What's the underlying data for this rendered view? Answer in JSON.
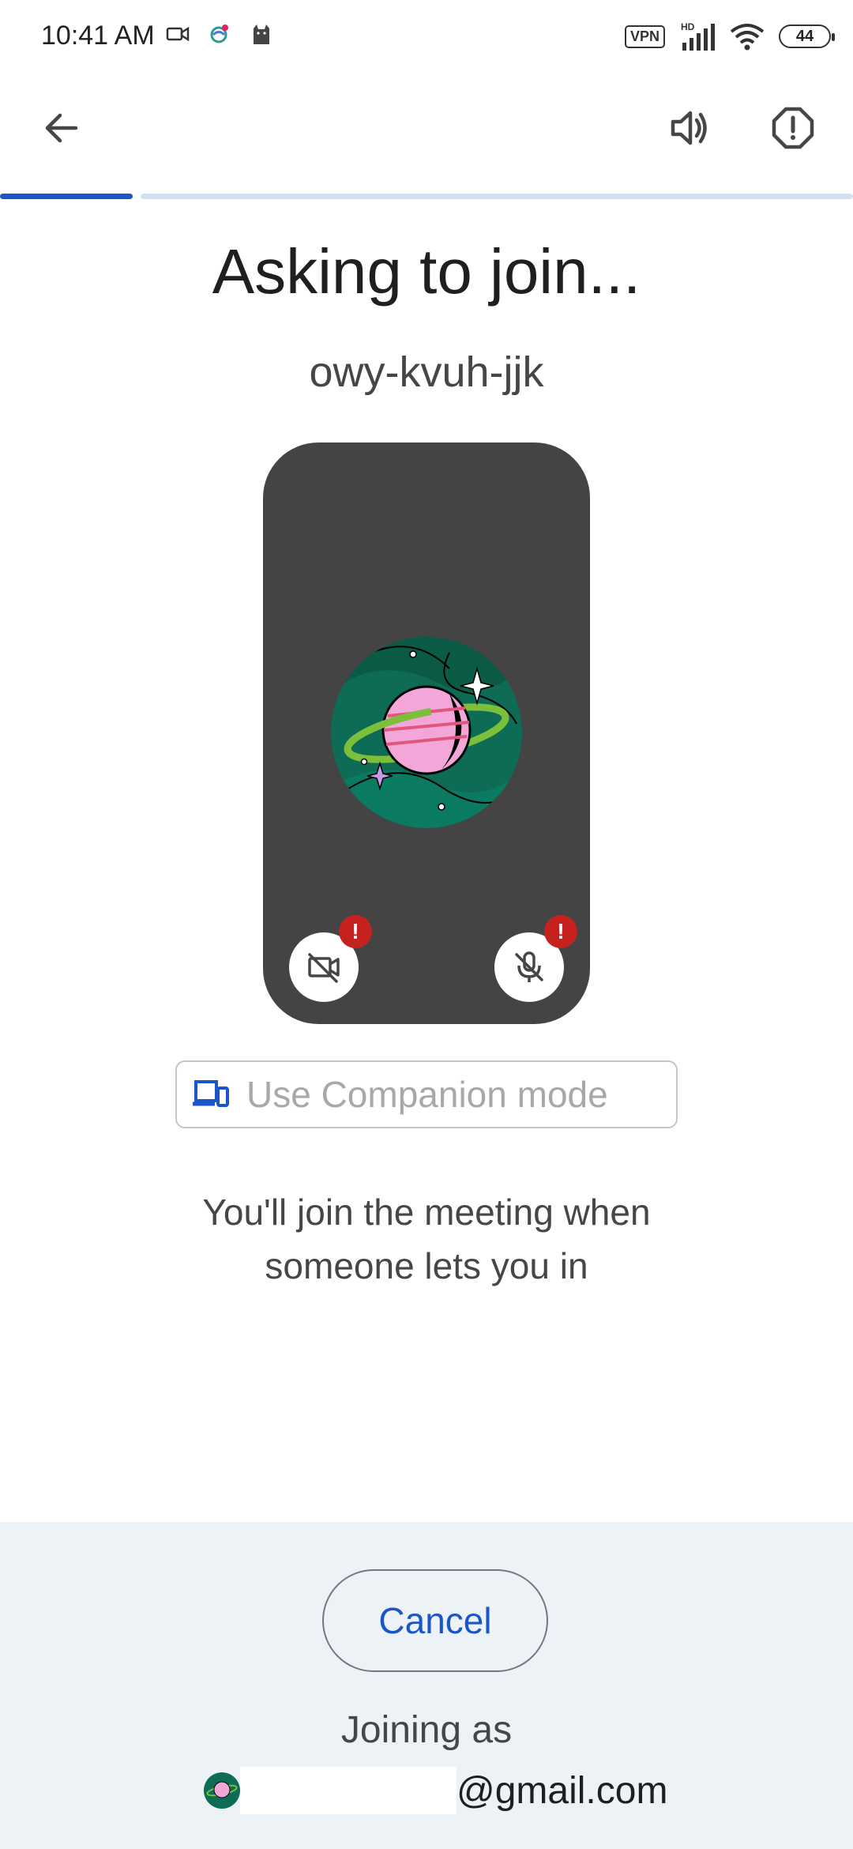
{
  "status_bar": {
    "time": "10:41 AM",
    "vpn": "VPN",
    "network": "HD",
    "battery": "44"
  },
  "top_bar": {
    "back_icon": "arrow-back-icon",
    "speaker_icon": "volume-up-icon",
    "report_icon": "report-icon"
  },
  "page": {
    "title": "Asking to join...",
    "meeting_code": "owy-kvuh-jjk",
    "companion_label": "Use Companion mode",
    "info_line1": "You'll join the meeting when",
    "info_line2": "someone lets you in"
  },
  "preview": {
    "camera_icon": "videocam-off-icon",
    "mic_icon": "mic-off-icon",
    "warning_mark": "!"
  },
  "bottom": {
    "cancel_label": "Cancel",
    "joining_as": "Joining as",
    "email_domain": "@gmail.com"
  },
  "colors": {
    "accent": "#1a56c7",
    "preview_bg": "#444444",
    "warning": "#c5221f",
    "sheet_bg": "#edf2f7"
  }
}
